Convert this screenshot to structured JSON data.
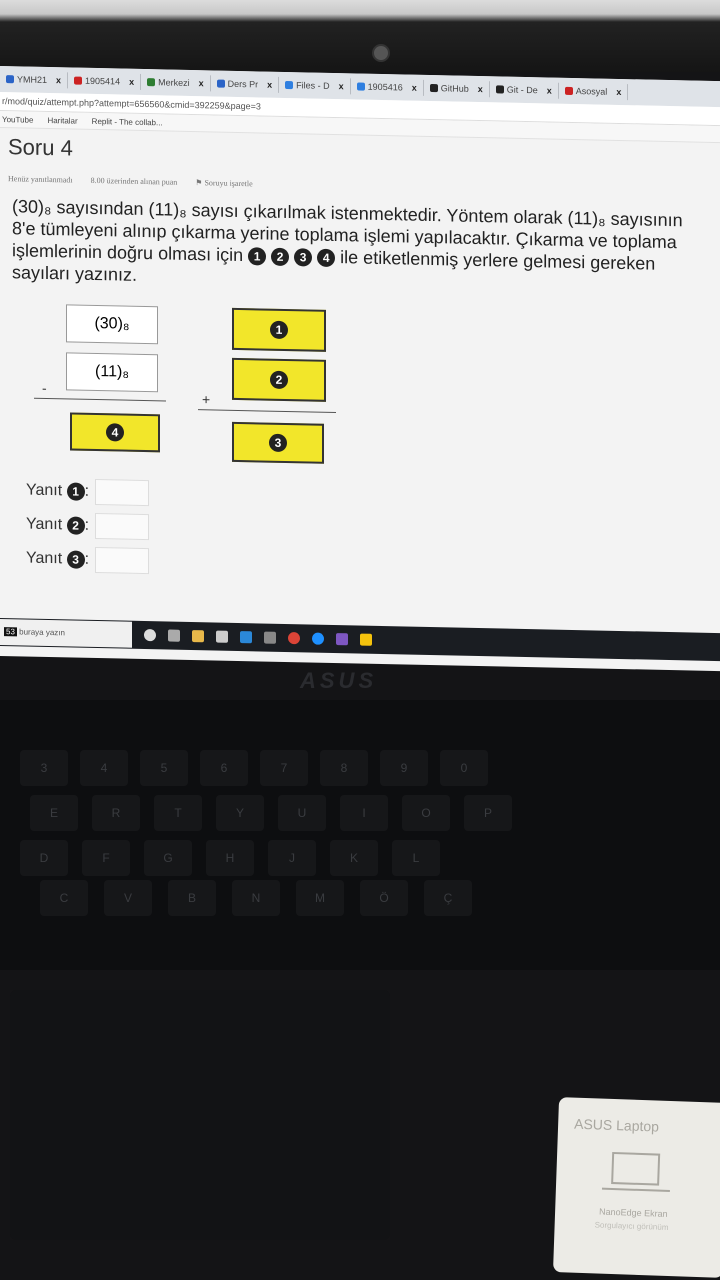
{
  "browser": {
    "tabs": [
      {
        "label": "YMH21",
        "color": "#2b64c7"
      },
      {
        "label": "1905414",
        "color": "#c22"
      },
      {
        "label": "Merkezi",
        "color": "#2e7d32"
      },
      {
        "label": "Ders Pr",
        "color": "#2b64c7"
      },
      {
        "label": "Files - D",
        "color": "#2f7fe0"
      },
      {
        "label": "1905416",
        "color": "#2f7fe0"
      },
      {
        "label": "GitHub",
        "color": "#222"
      },
      {
        "label": "Git - De",
        "color": "#222"
      },
      {
        "label": "Asosyal",
        "color": "#c22"
      }
    ],
    "tab_close": "x",
    "url": "r/mod/quiz/attempt.php?attempt=656560&cmid=392259&page=3",
    "bookmarks": [
      "YouTube",
      "Haritalar",
      "Replit - The collab..."
    ]
  },
  "quiz": {
    "title": "Soru 4",
    "status": "Henüz yanıtlanmadı",
    "points": "8.00 üzerinden alınan puan",
    "flag": "Soruyu işaretle",
    "question_p1": "(30)₈ sayısından (11)₈ sayısı çıkarılmak istenmektedir. Yöntem olarak (11)₈ sayısının 8'e tümleyeni alınıp çıkarma yerine toplama işlemi yapılacaktır. Çıkarma ve toplama işlemlerinin doğru olması için",
    "question_p2": "ile etiketlenmiş yerlere gelmesi gereken sayıları yazınız.",
    "markers": [
      "1",
      "2",
      "3",
      "4"
    ],
    "diagram": {
      "minuend": "(30)₈",
      "subtrahend": "(11)₈",
      "minus": "-",
      "plus": "+",
      "result_marker": "4",
      "add_markers": [
        "1",
        "2",
        "3"
      ]
    },
    "answers": [
      {
        "label": "Yanıt",
        "marker": "1"
      },
      {
        "label": "Yanıt",
        "marker": "2"
      },
      {
        "label": "Yanıt",
        "marker": "3"
      }
    ]
  },
  "taskbar": {
    "search_placeholder": "buraya yazın",
    "clock_fragment": "53"
  },
  "laptop": {
    "brand": "ASUS",
    "keys": [
      "3",
      "4",
      "5",
      "6",
      "7",
      "8",
      "9",
      "0",
      "E",
      "R",
      "T",
      "Y",
      "U",
      "I",
      "O",
      "P",
      "D",
      "F",
      "G",
      "H",
      "J",
      "K",
      "L",
      "C",
      "V",
      "B",
      "N",
      "M",
      "Ö",
      "Ç"
    ],
    "sticker_title": "ASUS Laptop",
    "sticker_line1": "NanoEdge Ekran",
    "sticker_line2": "Sorgulayıcı görünüm"
  }
}
